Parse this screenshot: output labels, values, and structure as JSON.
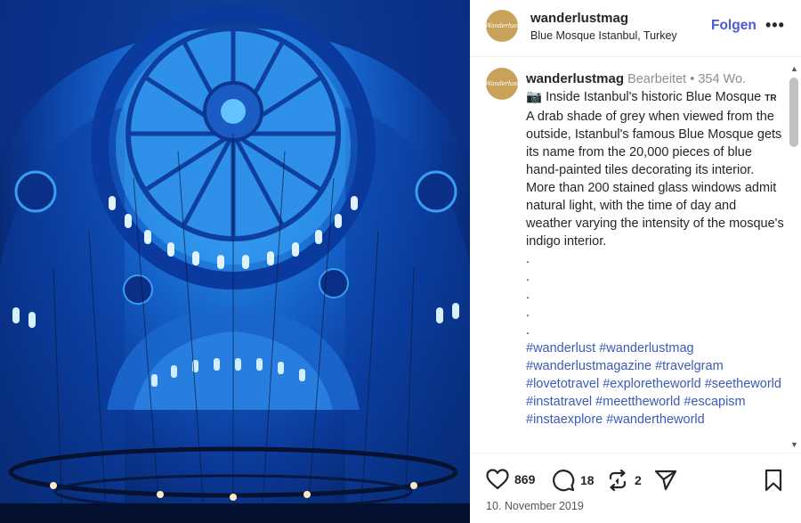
{
  "post": {
    "avatar_text": "Wanderlust",
    "username": "wanderlustmag",
    "location": "Blue Mosque Istanbul, Turkey",
    "follow_label": "Folgen",
    "more_label": "•••",
    "caption": {
      "username": "wanderlustmag",
      "edited": "Bearbeitet",
      "separator": "•",
      "age": "354 Wo.",
      "camera_emoji": "📷",
      "text": "Inside Istanbul's historic Blue Mosque 🇹🇷 A drab shade of grey when viewed from the outside, Istanbul's famous Blue Mosque gets its name from the 20,000 pieces of blue hand-painted tiles decorating its interior. More than 200 stained glass windows admit natural light, with the time of day and weather varying the intensity of the mosque's indigo interior.",
      "flag_text": "TR",
      "text_before_flag": "Inside Istanbul's historic Blue Mosque",
      "text_after_flag": "A drab shade of grey when viewed from the outside, Istanbul's famous Blue Mosque gets its name from the 20,000 pieces of blue hand-painted tiles decorating its interior. More than 200 stained glass windows admit natural light, with the time of day and weather varying the intensity of the mosque's indigo interior.",
      "dots": [
        ".",
        ".",
        ".",
        ".",
        "."
      ],
      "hashtags": "#wanderlust #wanderlustmag #wanderlustmagazine #travelgram #lovetotravel #exploretheworld #seetheworld #instatravel #meettheworld #escapism #instaexplore #wandertheworld"
    },
    "actions": {
      "likes": "869",
      "comments": "18",
      "reposts": "2"
    },
    "date": "10. November 2019"
  },
  "colors": {
    "accent": "#4a5bd6",
    "hashtag": "#3b5bb8",
    "avatar_bg": "#c9a25a",
    "text": "#262626",
    "muted": "#8e8e8e"
  },
  "icons": {
    "like": "heart-icon",
    "comment": "speech-bubble-icon",
    "repost": "repost-icon",
    "share": "paper-plane-icon",
    "save": "bookmark-icon"
  }
}
